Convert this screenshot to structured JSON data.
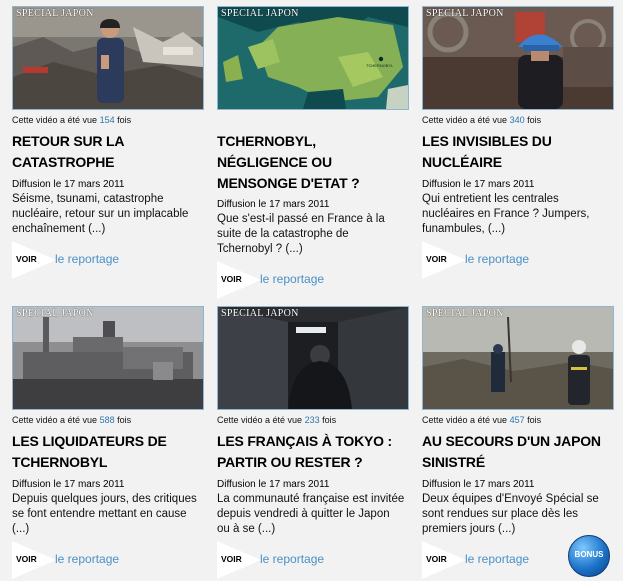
{
  "common": {
    "stamp": "SPECIAL JAPON",
    "views_prefix": "Cette vidéo a été vue",
    "views_suffix": "fois",
    "voir": "VOIR",
    "reportage": "le reportage"
  },
  "cards": [
    {
      "views": "154",
      "title": "RETOUR SUR LA CATASTROPHE",
      "date": "Diffusion le 17 mars 2011",
      "desc": "Séisme, tsunami, catastrophe nucléaire, retour sur un implacable enchaînement (...)"
    },
    {
      "views": "",
      "title": "TCHERNOBYL, NÉGLIGENCE OU MENSONGE D'ETAT ?",
      "date": "Diffusion le 17 mars 2011",
      "desc": "Que s'est-il passé en France à la suite de la catastrophe de Tchernobyl ? (...)",
      "map_label": "TCHERNOBYL"
    },
    {
      "views": "340",
      "title": "LES INVISIBLES DU NUCLÉAIRE",
      "date": "Diffusion le 17 mars 2011",
      "desc": "Qui entretient les centrales nucléaires en France ? Jumpers, funambules, (...)"
    },
    {
      "views": "588",
      "title": "LES LIQUIDATEURS DE TCHERNOBYL",
      "date": "Diffusion le 17 mars 2011",
      "desc": "Depuis quelques jours, des critiques se font entendre mettant en cause (...)"
    },
    {
      "views": "233",
      "title": "LES FRANÇAIS À TOKYO : PARTIR OU RESTER ?",
      "date": "Diffusion le 17 mars 2011",
      "desc": "La communauté française est invitée depuis vendredi à quitter le Japon ou à se (...)"
    },
    {
      "views": "457",
      "title": "AU SECOURS D'UN JAPON SINISTRÉ",
      "date": "Diffusion le 17 mars 2011",
      "desc": "Deux équipes d'Envoyé Spécial se sont rendues sur place dès les premiers jours (...)"
    }
  ],
  "bonus_label": "BONUS"
}
